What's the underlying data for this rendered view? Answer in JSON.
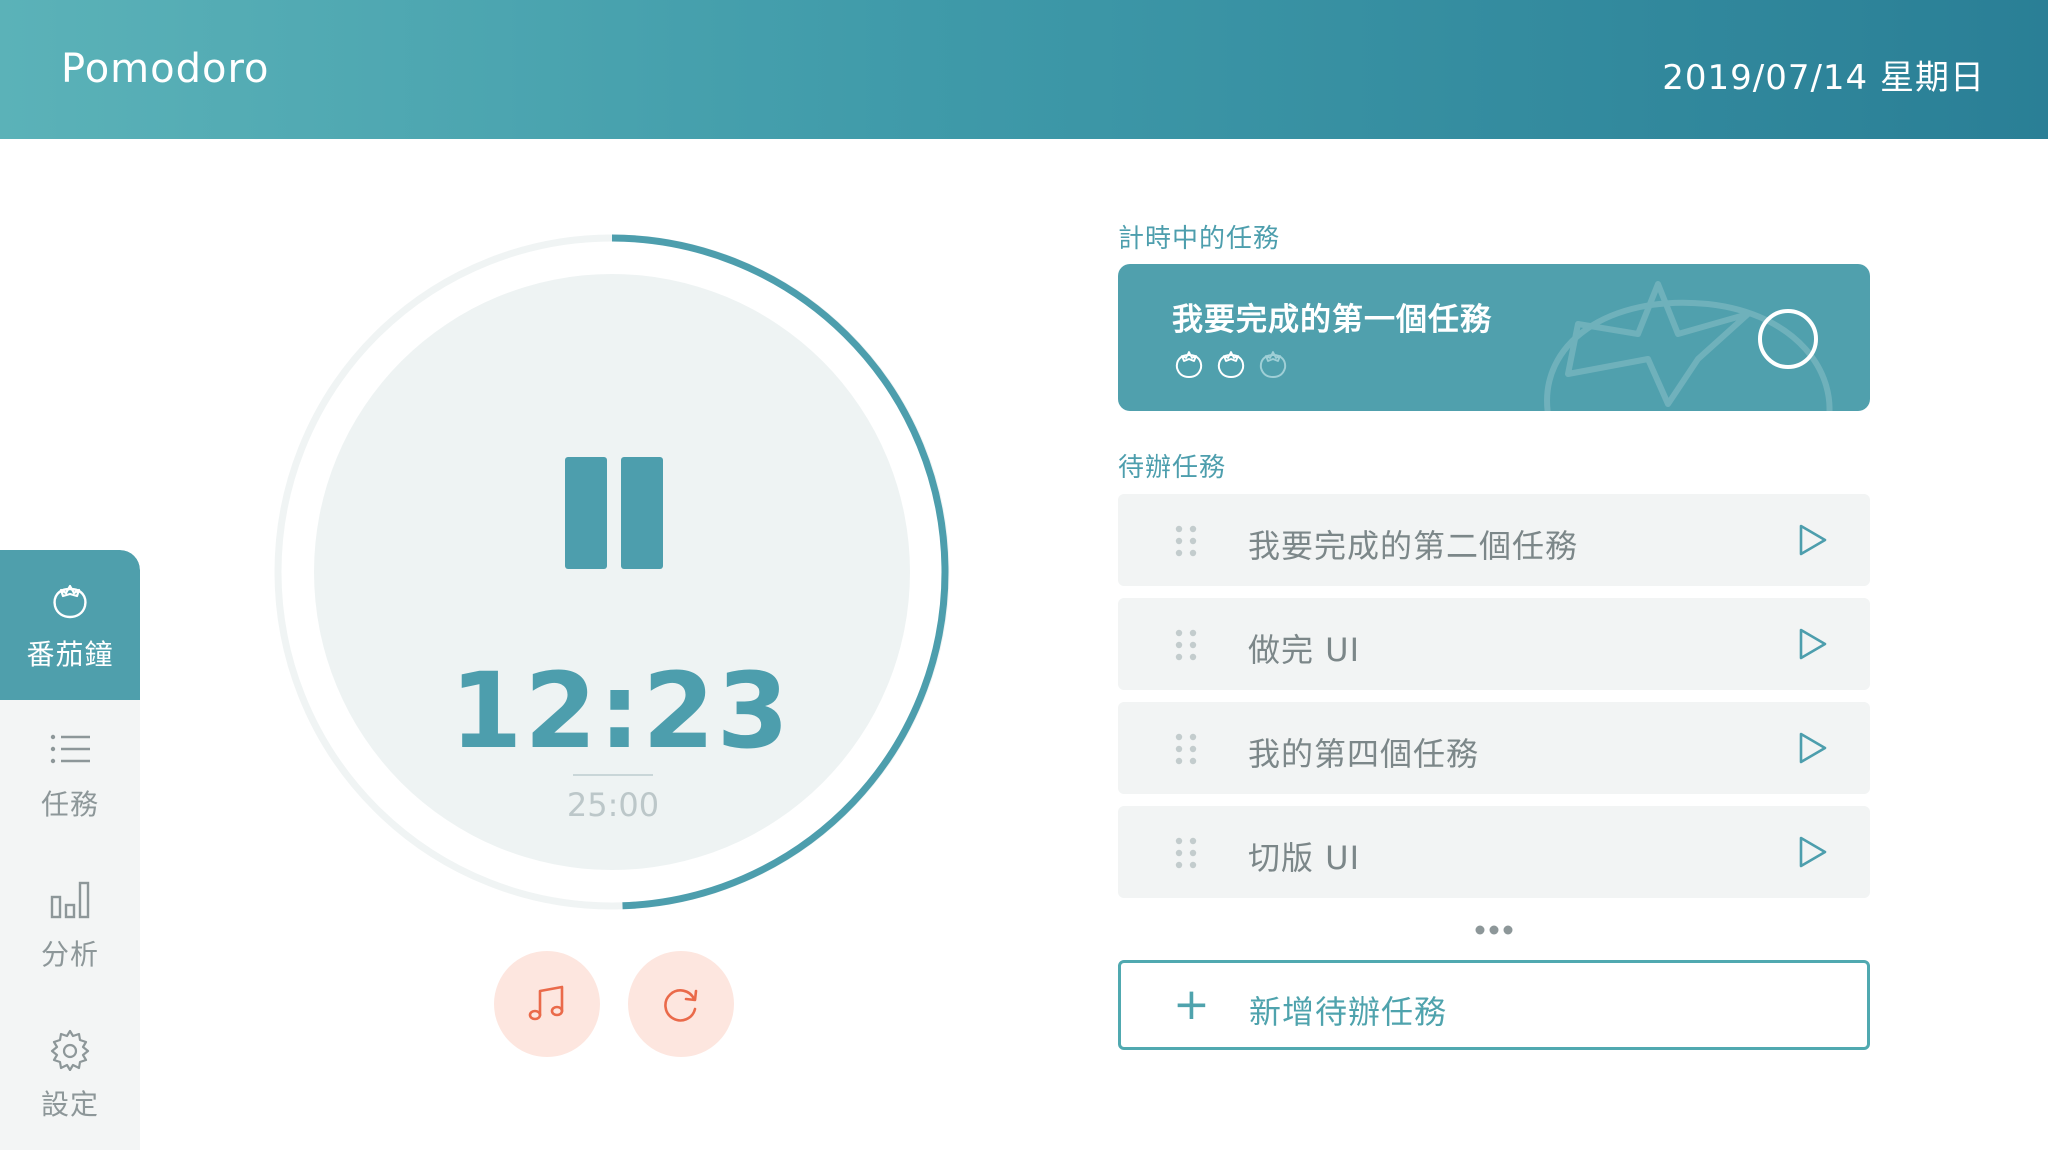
{
  "header": {
    "app_title": "Pomodoro",
    "date": "2019/07/14 星期日"
  },
  "sidebar": {
    "items": [
      {
        "label": "番茄鐘",
        "icon": "tomato-icon",
        "active": true
      },
      {
        "label": "任務",
        "icon": "list-icon",
        "active": false
      },
      {
        "label": "分析",
        "icon": "bar-chart-icon",
        "active": false
      },
      {
        "label": "設定",
        "icon": "gear-icon",
        "active": false
      }
    ]
  },
  "timer": {
    "current": "12:23",
    "total": "25:00",
    "progress_remaining_fraction": 0.495,
    "state": "running"
  },
  "current_task": {
    "section_label": "計時中的任務",
    "title": "我要完成的第一個任務",
    "tomatoes_done": 2,
    "tomatoes_total": 3
  },
  "todo": {
    "section_label": "待辦任務",
    "items": [
      {
        "label": "我要完成的第二個任務"
      },
      {
        "label": "做完 UI"
      },
      {
        "label": "我的第四個任務"
      },
      {
        "label": "切版 UI"
      }
    ],
    "add_label": "新增待辦任務"
  },
  "colors": {
    "accent": "#4d9ead",
    "header_start": "#5bb2b8",
    "header_end": "#2a7f96",
    "secondary_button": "#fde6df",
    "secondary_icon": "#ea6a4a"
  }
}
